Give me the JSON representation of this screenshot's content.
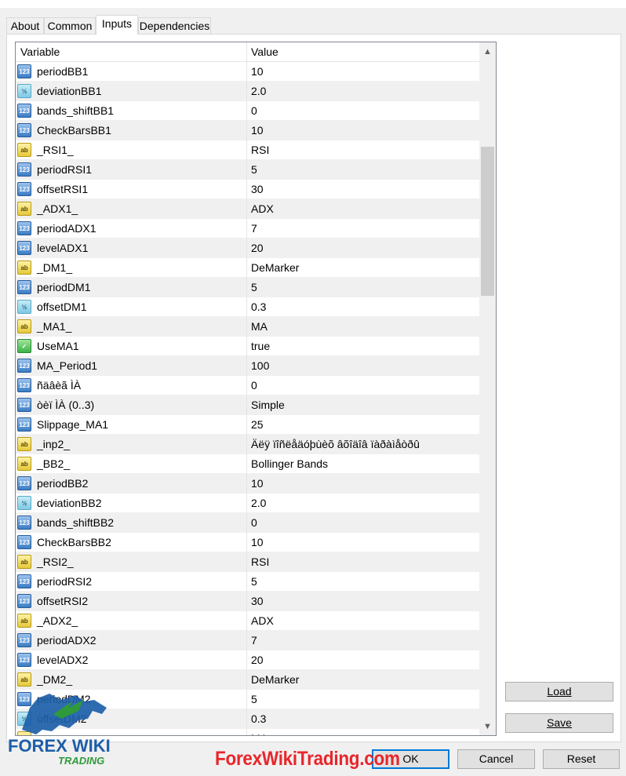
{
  "tabs": [
    {
      "label": "About",
      "active": false
    },
    {
      "label": "Common",
      "active": false
    },
    {
      "label": "Inputs",
      "active": true
    },
    {
      "label": "Dependencies",
      "active": false
    }
  ],
  "grid": {
    "headers": {
      "variable": "Variable",
      "value": "Value"
    },
    "rows": [
      {
        "type": "int",
        "icon": "123",
        "name": "periodBB1",
        "value": "10"
      },
      {
        "type": "double",
        "icon": "½",
        "name": "deviationBB1",
        "value": "2.0"
      },
      {
        "type": "int",
        "icon": "123",
        "name": "bands_shiftBB1",
        "value": "0"
      },
      {
        "type": "int",
        "icon": "123",
        "name": "CheckBarsBB1",
        "value": "10"
      },
      {
        "type": "string",
        "icon": "ab",
        "name": "_RSI1_",
        "value": "RSI"
      },
      {
        "type": "int",
        "icon": "123",
        "name": "periodRSI1",
        "value": "5"
      },
      {
        "type": "int",
        "icon": "123",
        "name": "offsetRSI1",
        "value": "30"
      },
      {
        "type": "string",
        "icon": "ab",
        "name": "_ADX1_",
        "value": "ADX"
      },
      {
        "type": "int",
        "icon": "123",
        "name": "periodADX1",
        "value": "7"
      },
      {
        "type": "int",
        "icon": "123",
        "name": "levelADX1",
        "value": "20"
      },
      {
        "type": "string",
        "icon": "ab",
        "name": "_DM1_",
        "value": "DeMarker"
      },
      {
        "type": "int",
        "icon": "123",
        "name": "periodDM1",
        "value": "5"
      },
      {
        "type": "double",
        "icon": "½",
        "name": "offsetDM1",
        "value": "0.3"
      },
      {
        "type": "string",
        "icon": "ab",
        "name": "_MA1_",
        "value": "MA"
      },
      {
        "type": "bool",
        "icon": "✓",
        "name": "UseMA1",
        "value": "true"
      },
      {
        "type": "int",
        "icon": "123",
        "name": "MA_Period1",
        "value": "100"
      },
      {
        "type": "int",
        "icon": "123",
        "name": "ñäâèã ÌÀ",
        "value": "0"
      },
      {
        "type": "int",
        "icon": "123",
        "name": "òèï ÌÀ (0..3)",
        "value": "Simple"
      },
      {
        "type": "int",
        "icon": "123",
        "name": "Slippage_MA1",
        "value": "25"
      },
      {
        "type": "string",
        "icon": "ab",
        "name": "_inp2_",
        "value": "Äëÿ ïîñëåäóþùèõ âõîäîâ ïàðàìåòðû"
      },
      {
        "type": "string",
        "icon": "ab",
        "name": "_BB2_",
        "value": "Bollinger Bands"
      },
      {
        "type": "int",
        "icon": "123",
        "name": "periodBB2",
        "value": "10"
      },
      {
        "type": "double",
        "icon": "½",
        "name": "deviationBB2",
        "value": "2.0"
      },
      {
        "type": "int",
        "icon": "123",
        "name": "bands_shiftBB2",
        "value": "0"
      },
      {
        "type": "int",
        "icon": "123",
        "name": "CheckBarsBB2",
        "value": "10"
      },
      {
        "type": "string",
        "icon": "ab",
        "name": "_RSI2_",
        "value": "RSI"
      },
      {
        "type": "int",
        "icon": "123",
        "name": "periodRSI2",
        "value": "5"
      },
      {
        "type": "int",
        "icon": "123",
        "name": "offsetRSI2",
        "value": "30"
      },
      {
        "type": "string",
        "icon": "ab",
        "name": "_ADX2_",
        "value": "ADX"
      },
      {
        "type": "int",
        "icon": "123",
        "name": "periodADX2",
        "value": "7"
      },
      {
        "type": "int",
        "icon": "123",
        "name": "levelADX2",
        "value": "20"
      },
      {
        "type": "string",
        "icon": "ab",
        "name": "_DM2_",
        "value": "DeMarker"
      },
      {
        "type": "int",
        "icon": "123",
        "name": "periodDM2",
        "value": "5"
      },
      {
        "type": "double",
        "icon": "½",
        "name": "offsetDM2",
        "value": "0.3"
      },
      {
        "type": "string",
        "icon": "ab",
        "name": "",
        "value": "MA"
      }
    ]
  },
  "buttons": {
    "load": "Load",
    "save": "Save",
    "ok": "OK",
    "cancel": "Cancel",
    "reset": "Reset"
  },
  "watermark": {
    "logo_main": "FOREX WIKI",
    "logo_sub": "TRADING",
    "site": "ForexWikiTrading.com"
  },
  "colors": {
    "accent": "#0078d7",
    "watermark_red": "#e8262b",
    "logo_blue": "#1d5ea8",
    "logo_green": "#2e9a3a"
  }
}
